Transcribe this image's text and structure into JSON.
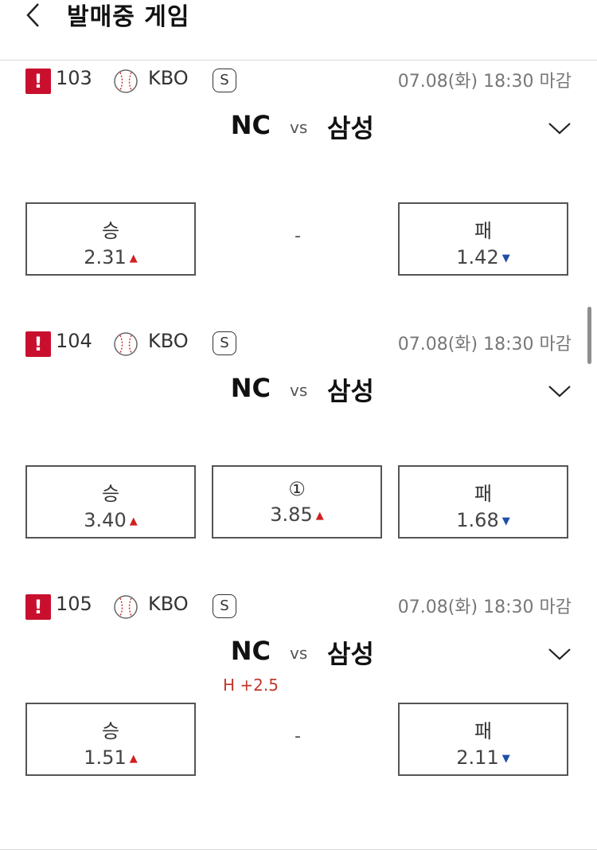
{
  "header": {
    "title": "발매중 게임"
  },
  "games": [
    {
      "number": "103",
      "alert": "!",
      "league": "KBO",
      "badge": "S",
      "deadline": "07.08(화) 18:30 마감",
      "home": "NC",
      "vs": "vs",
      "away": "삼성",
      "handicap": "",
      "win": {
        "label": "승",
        "odds": "2.31",
        "trend": "up"
      },
      "draw": {
        "label": "-",
        "odds": ""
      },
      "lose": {
        "label": "패",
        "odds": "1.42",
        "trend": "down"
      }
    },
    {
      "number": "104",
      "alert": "!",
      "league": "KBO",
      "badge": "S",
      "deadline": "07.08(화) 18:30 마감",
      "home": "NC",
      "vs": "vs",
      "away": "삼성",
      "handicap": "",
      "win": {
        "label": "승",
        "odds": "3.40",
        "trend": "up"
      },
      "draw": {
        "label": "①",
        "odds": "3.85",
        "trend": "up"
      },
      "lose": {
        "label": "패",
        "odds": "1.68",
        "trend": "down"
      }
    },
    {
      "number": "105",
      "alert": "!",
      "league": "KBO",
      "badge": "S",
      "deadline": "07.08(화) 18:30 마감",
      "home": "NC",
      "vs": "vs",
      "away": "삼성",
      "handicap": "H +2.5",
      "win": {
        "label": "승",
        "odds": "1.51",
        "trend": "up"
      },
      "draw": {
        "label": "-",
        "odds": ""
      },
      "lose": {
        "label": "패",
        "odds": "2.11",
        "trend": "down"
      }
    }
  ],
  "icons": {
    "back": "chevron-left-icon",
    "alert": "exclamation-icon",
    "sport": "baseball-icon",
    "expand": "chevron-down-icon",
    "up": "triangle-up-icon",
    "down": "triangle-down-icon"
  },
  "colors": {
    "alert": "#c8102e",
    "up": "#d02020",
    "down": "#1d4fa8",
    "handicap": "#c0392b"
  }
}
